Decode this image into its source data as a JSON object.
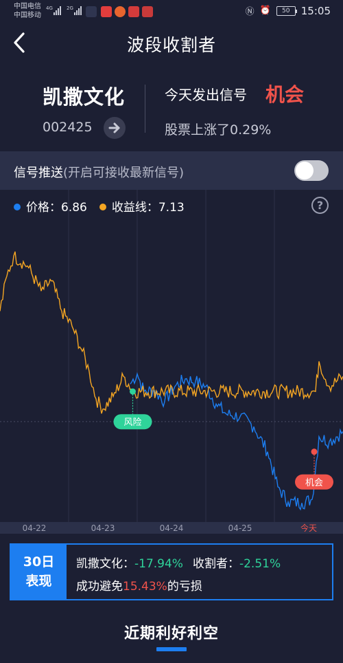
{
  "status_bar": {
    "carrier1": "中国电信",
    "carrier2": "中国移动",
    "net1": "4G",
    "net2": "2G",
    "time": "15:05",
    "battery": "50",
    "nfc_icon": "nfc-icon",
    "alarm_icon": "alarm-icon"
  },
  "header": {
    "title": "波段收割者",
    "back_icon": "chevron-left-icon"
  },
  "stock": {
    "name": "凯撒文化",
    "code": "002425",
    "signal_prefix": "今天发出信号",
    "signal_type": "机会",
    "rise_text": "股票上涨了0.29%"
  },
  "push": {
    "label": "信号推送",
    "sublabel": "(开启可接收最新信号)",
    "enabled": false
  },
  "legend": {
    "price_label": "价格：",
    "price_value": "6.86",
    "yield_label": "收益线：",
    "yield_value": "7.13",
    "help": "?"
  },
  "colors": {
    "price": "#1d7ef0",
    "yield": "#f5a623",
    "risk": "#2fd39a",
    "opportunity": "#f0534b",
    "accent": "#1d7ef0"
  },
  "chart_data": {
    "type": "line",
    "categories": [
      "04-22",
      "04-23",
      "04-24",
      "04-25",
      "今天"
    ],
    "series": [
      {
        "name": "价格",
        "color": "#1d7ef0",
        "segment_from": 0.38,
        "keypoints": [
          [
            0.38,
            0.75
          ],
          [
            0.4,
            0.95
          ],
          [
            0.42,
            0.6
          ],
          [
            0.45,
            0.62
          ],
          [
            0.48,
            0.4
          ],
          [
            0.51,
            0.7
          ],
          [
            0.54,
            0.85
          ],
          [
            0.57,
            0.8
          ],
          [
            0.6,
            0.7
          ],
          [
            0.63,
            0.35
          ],
          [
            0.66,
            0.15
          ],
          [
            0.7,
            0.1
          ],
          [
            0.74,
            -0.1
          ],
          [
            0.78,
            -0.6
          ],
          [
            0.81,
            -1.3
          ],
          [
            0.84,
            -1.6
          ],
          [
            0.88,
            -1.62
          ],
          [
            0.91,
            -1.55
          ],
          [
            0.93,
            -0.3
          ],
          [
            0.96,
            -0.4
          ],
          [
            1.0,
            -0.2
          ]
        ]
      },
      {
        "name": "收益线",
        "color": "#f5a623",
        "keypoints": [
          [
            0.0,
            2.2
          ],
          [
            0.02,
            2.9
          ],
          [
            0.04,
            3.3
          ],
          [
            0.08,
            3.1
          ],
          [
            0.12,
            2.6
          ],
          [
            0.15,
            2.8
          ],
          [
            0.18,
            2.2
          ],
          [
            0.21,
            1.9
          ],
          [
            0.24,
            1.4
          ],
          [
            0.26,
            1.0
          ],
          [
            0.28,
            0.45
          ],
          [
            0.3,
            0.25
          ],
          [
            0.33,
            0.5
          ],
          [
            0.36,
            0.9
          ],
          [
            0.39,
            0.6
          ],
          [
            0.92,
            0.6
          ],
          [
            0.93,
            1.2
          ],
          [
            0.96,
            0.7
          ],
          [
            1.0,
            0.9
          ]
        ]
      }
    ],
    "markers": [
      {
        "label": "风险",
        "x": 0.387,
        "y": 0.6,
        "color": "#2fd39a",
        "placement": "below"
      },
      {
        "label": "机会",
        "x": 0.916,
        "y": -0.6,
        "color": "#f0534b",
        "placement": "below"
      }
    ],
    "reference_y": 0.0,
    "ylim": [
      -2.0,
      4.0
    ],
    "grid": true,
    "legend": "top-left"
  },
  "performance": {
    "box_title_1": "30日",
    "box_title_2": "表现",
    "stock_label": "凯撒文化：",
    "stock_change": "-17.94%",
    "reaper_label": "收割者：",
    "reaper_change": "-2.51%",
    "avoid_prefix": "成功避免",
    "avoid_value": "15.43%",
    "avoid_suffix": "的亏损"
  },
  "bottom": {
    "title": "近期利好利空"
  }
}
